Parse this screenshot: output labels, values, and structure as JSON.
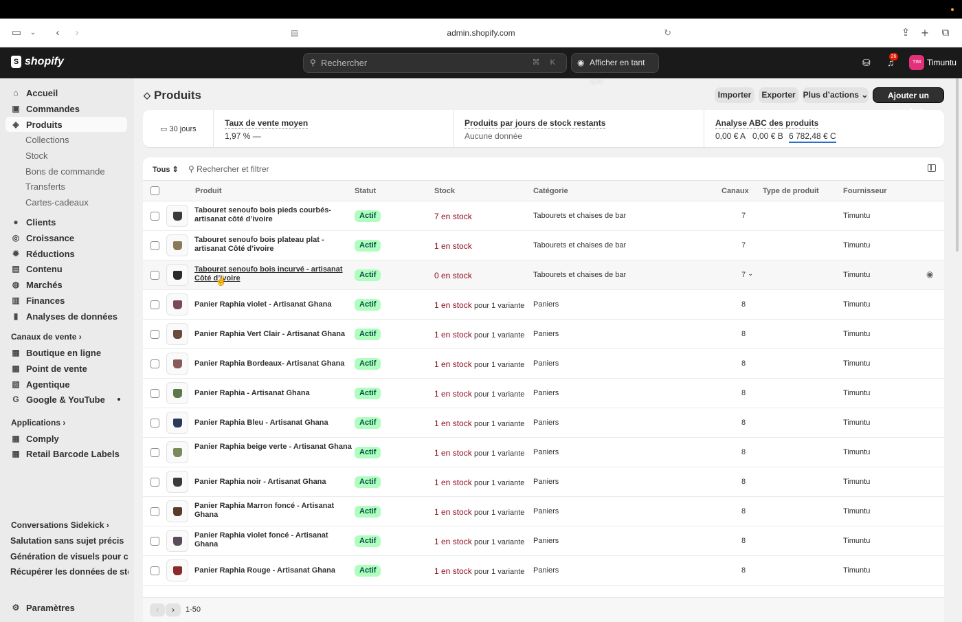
{
  "browser": {
    "url": "admin.shopify.com"
  },
  "topbar": {
    "logo": "shopify",
    "search_placeholder": "Rechercher",
    "search_shortcut": "⌘ K",
    "view_as": "Afficher en tant que",
    "notif_count": "26",
    "avatar_initials": "TIM",
    "store_name": "Timuntu"
  },
  "sidebar": {
    "main": [
      "Accueil",
      "Commandes",
      "Produits"
    ],
    "products_sub": [
      "Collections",
      "Stock",
      "Bons de commande",
      "Transferts",
      "Cartes-cadeaux"
    ],
    "more": [
      "Clients",
      "Croissance",
      "Réductions",
      "Contenu",
      "Marchés",
      "Finances",
      "Analyses de données"
    ],
    "sales_channels_title": "Canaux de vente",
    "sales_channels": [
      "Boutique en ligne",
      "Point de vente",
      "Agentique",
      "Google & YouTube"
    ],
    "apps_title": "Applications",
    "apps": [
      "Comply",
      "Retail Barcode Labels"
    ],
    "sidekick_title": "Conversations Sidekick",
    "sidekick": [
      "Salutation sans sujet précis",
      "Génération de visuels pour cou...",
      "Récupérer les données de stoc..."
    ],
    "settings": "Paramètres"
  },
  "page": {
    "title": "Produits",
    "import": "Importer",
    "export": "Exporter",
    "more_actions": "Plus d’actions",
    "add_product": "Ajouter un produit"
  },
  "stats": {
    "period": "30 jours",
    "sell_rate_title": "Taux de vente moyen",
    "sell_rate_value": "1,97 %",
    "sell_rate_trend": "—",
    "days_stock_title": "Produits par jours de stock restants",
    "days_stock_value": "Aucune donnée",
    "abc_title": "Analyse ABC des produits",
    "abc_a": "0,00 € A",
    "abc_b": "0,00 € B",
    "abc_c": "6 782,48 € C"
  },
  "table": {
    "filter_tab": "Tous",
    "filter_placeholder": "Rechercher et filtrer",
    "headers": {
      "product": "Produit",
      "status": "Statut",
      "stock": "Stock",
      "category": "Catégorie",
      "channels": "Canaux",
      "type": "Type de produit",
      "vendor": "Fournisseur"
    },
    "rows": [
      {
        "name": "Tabouret senoufo bois pieds courbés- artisanat côté d’ivoire",
        "status": "Actif",
        "stock": "7 en stock",
        "suffix": "",
        "category": "Tabourets et chaises de bar",
        "channels": "7",
        "vendor": "Timuntu",
        "color": "#3a3a3a"
      },
      {
        "name": "Tabouret senoufo bois plateau plat - artisanat Côté d’ivoire",
        "status": "Actif",
        "stock": "1 en stock",
        "suffix": "",
        "category": "Tabourets et chaises de bar",
        "channels": "7",
        "vendor": "Timuntu",
        "color": "#8a7a5a"
      },
      {
        "name": "Tabouret senoufo bois incurvé - artisanat Côté d’ivoire",
        "status": "Actif",
        "stock": "0 en stock",
        "suffix": "",
        "category": "Tabourets et chaises de bar",
        "channels": "7",
        "vendor": "Timuntu",
        "color": "#2a2a2a"
      },
      {
        "name": "Panier Raphia violet - Artisanat Ghana",
        "status": "Actif",
        "stock": "1 en stock",
        "suffix": "pour 1 variante",
        "category": "Paniers",
        "channels": "8",
        "vendor": "Timuntu",
        "color": "#7a4a5a"
      },
      {
        "name": "Panier Raphia Vert Clair - Artisanat Ghana",
        "status": "Actif",
        "stock": "1 en stock",
        "suffix": "pour 1 variante",
        "category": "Paniers",
        "channels": "8",
        "vendor": "Timuntu",
        "color": "#6a4a3a"
      },
      {
        "name": "Panier Raphia Bordeaux- Artisanat Ghana",
        "status": "Actif",
        "stock": "1 en stock",
        "suffix": "pour 1 variante",
        "category": "Paniers",
        "channels": "8",
        "vendor": "Timuntu",
        "color": "#8a5a5a"
      },
      {
        "name": "Panier Raphia - Artisanat Ghana",
        "status": "Actif",
        "stock": "1 en stock",
        "suffix": "pour 1 variante",
        "category": "Paniers",
        "channels": "8",
        "vendor": "Timuntu",
        "color": "#5a7a4a"
      },
      {
        "name": "Panier Raphia Bleu - Artisanat Ghana",
        "status": "Actif",
        "stock": "1 en stock",
        "suffix": "pour 1 variante",
        "category": "Paniers",
        "channels": "8",
        "vendor": "Timuntu",
        "color": "#2a3a5a"
      },
      {
        "name": "Panier Raphia beige verte - Artisanat Ghana",
        "status": "Actif",
        "stock": "1 en stock",
        "suffix": "pour 1 variante",
        "category": "Paniers",
        "channels": "8",
        "vendor": "Timuntu",
        "color": "#7a8a5a"
      },
      {
        "name": "Panier Raphia noir - Artisanat Ghana",
        "status": "Actif",
        "stock": "1 en stock",
        "suffix": "pour 1 variante",
        "category": "Paniers",
        "channels": "8",
        "vendor": "Timuntu",
        "color": "#3a3a3a"
      },
      {
        "name": "Panier Raphia Marron foncé - Artisanat Ghana",
        "status": "Actif",
        "stock": "1 en stock",
        "suffix": "pour 1 variante",
        "category": "Paniers",
        "channels": "8",
        "vendor": "Timuntu",
        "color": "#5a3a2a"
      },
      {
        "name": "Panier Raphia violet foncé - Artisanat Ghana",
        "status": "Actif",
        "stock": "1 en stock",
        "suffix": "pour 1 variante",
        "category": "Paniers",
        "channels": "8",
        "vendor": "Timuntu",
        "color": "#5a4a5a"
      },
      {
        "name": "Panier Raphia Rouge - Artisanat Ghana",
        "status": "Actif",
        "stock": "1 en stock",
        "suffix": "pour 1 variante",
        "category": "Paniers",
        "channels": "8",
        "vendor": "Timuntu",
        "color": "#8a2a2a"
      }
    ]
  },
  "pagination": {
    "range": "1-50"
  }
}
